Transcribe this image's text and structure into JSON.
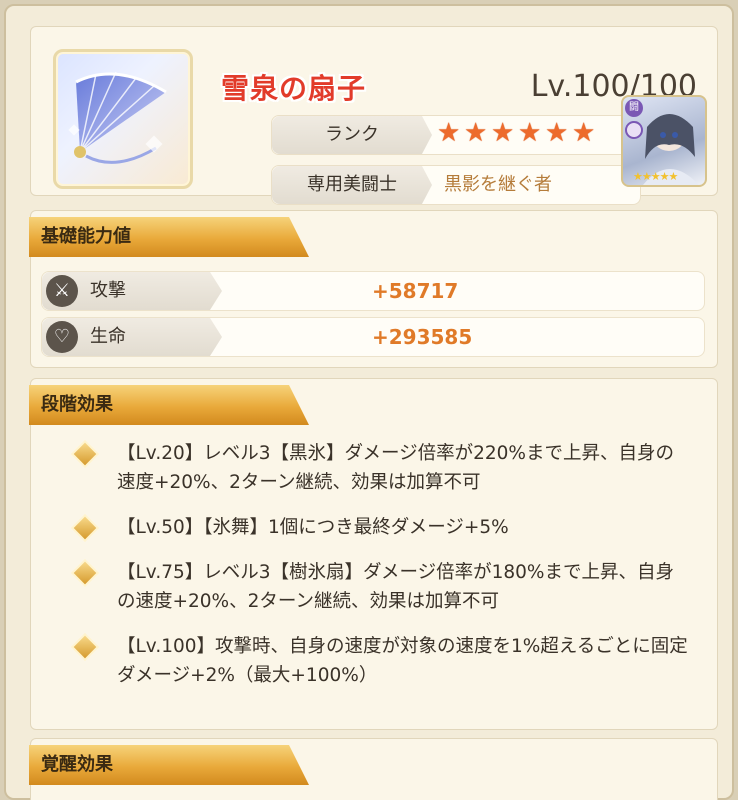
{
  "item": {
    "title": "雪泉の扇子",
    "level": "Lv.100/100",
    "rank_label": "ランク",
    "rank_stars": 6,
    "owner_label": "専用美闘士",
    "owner_value": "黒影を継ぐ者",
    "thumb_stars": 5
  },
  "base_stats": {
    "header": "基礎能力値",
    "rows": [
      {
        "name": "攻撃",
        "value": "+58717",
        "icon": "sword-icon"
      },
      {
        "name": "生命",
        "value": "+293585",
        "icon": "heart-icon"
      }
    ]
  },
  "stage_effects": {
    "header": "段階効果",
    "items": [
      "【Lv.20】レベル3【黒氷】ダメージ倍率が220%まで上昇、自身の速度+20%、2ターン継続、効果は加算不可",
      "【Lv.50】【氷舞】1個につき最終ダメージ+5%",
      "【Lv.75】レベル3【樹氷扇】ダメージ倍率が180%まで上昇、自身の速度+20%、2ターン継続、効果は加算不可",
      "【Lv.100】攻撃時、自身の速度が対象の速度を1%超えるごとに固定ダメージ+2%（最大+100%）"
    ]
  },
  "awaken_effects": {
    "header": "覚醒効果"
  },
  "colors": {
    "title_red": "#e23b2a",
    "stat_orange": "#e07a28",
    "star_orange": "#ed6b2c",
    "section_gold": "#e9a93a"
  }
}
